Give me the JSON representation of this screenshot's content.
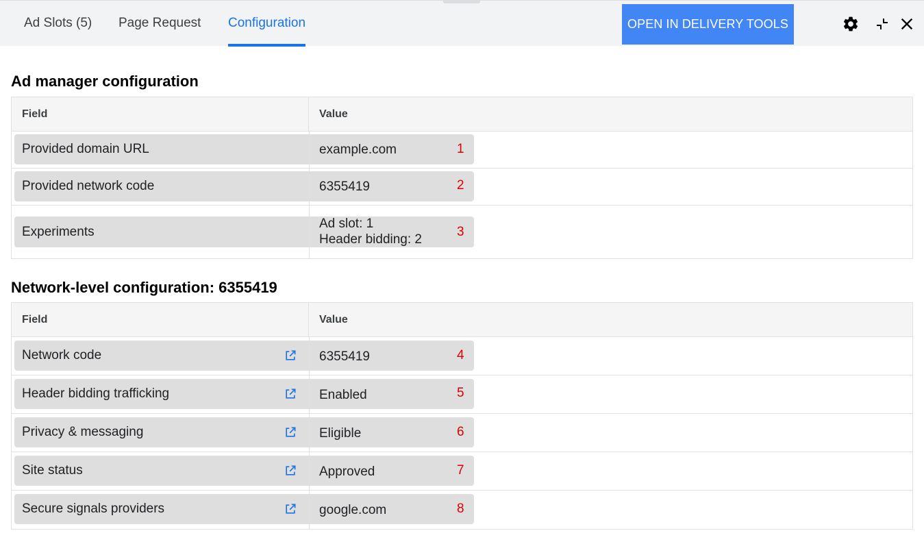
{
  "tabs": [
    {
      "label": "Ad Slots (5)"
    },
    {
      "label": "Page Request"
    },
    {
      "label": "Configuration",
      "active": true
    }
  ],
  "toolbar": {
    "open_button_label": "OPEN IN DELIVERY TOOLS",
    "icons": [
      "gear-icon",
      "minimize-icon",
      "close-icon"
    ]
  },
  "colors": {
    "accent": "#1a73e8",
    "button": "#4285f4",
    "marker": "#e00000",
    "pill": "#dedede"
  },
  "ad_manager": {
    "title": "Ad manager configuration",
    "header_field": "Field",
    "header_value": "Value",
    "rows": [
      {
        "field": "Provided domain URL",
        "value": "example.com",
        "marker": "1"
      },
      {
        "field": "Provided network code",
        "value": "6355419",
        "marker": "2"
      },
      {
        "field": "Experiments",
        "value": "Ad slot: 1",
        "value2": "Header bidding: 2",
        "marker": "3"
      }
    ]
  },
  "network": {
    "title": "Network-level configuration: 6355419",
    "header_field": "Field",
    "header_value": "Value",
    "rows": [
      {
        "field": "Network code",
        "value": "6355419",
        "marker": "4"
      },
      {
        "field": "Header bidding trafficking",
        "value": "Enabled",
        "marker": "5"
      },
      {
        "field": "Privacy & messaging",
        "value": "Eligible",
        "marker": "6"
      },
      {
        "field": "Site status",
        "value": "Approved",
        "marker": "7"
      },
      {
        "field": "Secure signals providers",
        "value": "google.com",
        "marker": "8"
      }
    ]
  }
}
